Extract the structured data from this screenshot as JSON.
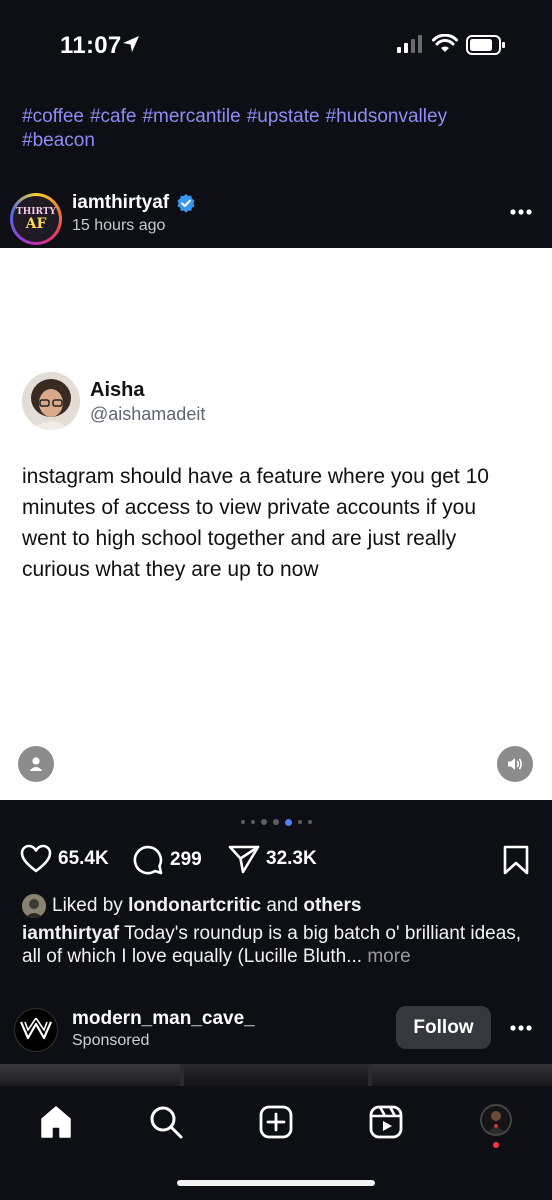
{
  "status_bar": {
    "time": "11:07"
  },
  "hashtags": [
    "#coffee",
    "#cafe",
    "#mercantile",
    "#upstate",
    "#hudsonvalley",
    "#beacon"
  ],
  "post": {
    "username": "iamthirtyaf",
    "time_ago": "15 hours ago",
    "avatar_text_top": "THIRTY",
    "avatar_text_bottom": "AF",
    "tweet": {
      "name": "Aisha",
      "handle": "@aishamadeit",
      "text": "instagram should have a feature where you get 10 minutes of access to view private accounts if you went to high school together and are just really curious what they are up to now"
    },
    "carousel": {
      "count": 7,
      "active_index": 4
    },
    "likes": "65.4K",
    "comments": "299",
    "shares": "32.3K",
    "liked_by_prefix": "Liked by",
    "liked_by_user": "londonartcritic",
    "liked_by_and": "and",
    "liked_by_others": "others",
    "caption_user": "iamthirtyaf",
    "caption_text": "Today's roundup is a big batch o' brilliant ideas, all of which I love equally (Lucille Bluth...",
    "caption_more": "more"
  },
  "sponsored": {
    "username": "modern_man_cave_",
    "label": "Sponsored",
    "follow_label": "Follow"
  },
  "nav": {
    "items": [
      "home-icon",
      "search-icon",
      "create-icon",
      "reels-icon",
      "profile-avatar"
    ]
  },
  "colors": {
    "background": "#0d0f14",
    "hashtag": "#8d8df5",
    "verified": "#3797f0",
    "carousel_active": "#4f7ef7",
    "notification": "#ff3040"
  }
}
